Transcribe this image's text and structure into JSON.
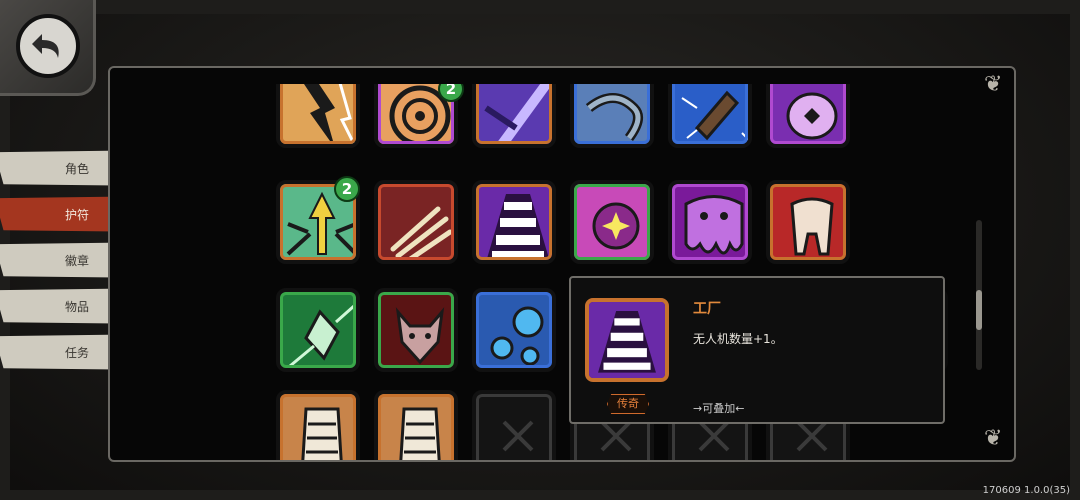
{
  "sidebar": {
    "items": [
      {
        "label": "角色",
        "active": false
      },
      {
        "label": "护符",
        "active": true
      },
      {
        "label": "徽章",
        "active": false
      },
      {
        "label": "物品",
        "active": false
      },
      {
        "label": "任务",
        "active": false
      }
    ]
  },
  "grid": {
    "badges": [
      "2",
      "2"
    ]
  },
  "tooltip": {
    "title": "工厂",
    "description": "无人机数量+1。",
    "rarity": "传奇",
    "stack_text": "→可叠加←"
  },
  "version": "170609 1.0.0(35)",
  "colors": {
    "legendary_rim": "#c7722e",
    "epic_rim": "#b04ad0",
    "rare_rim": "#3a6fd8",
    "uncommon_rim": "#3aa84a",
    "active_tab": "#a4361f"
  }
}
